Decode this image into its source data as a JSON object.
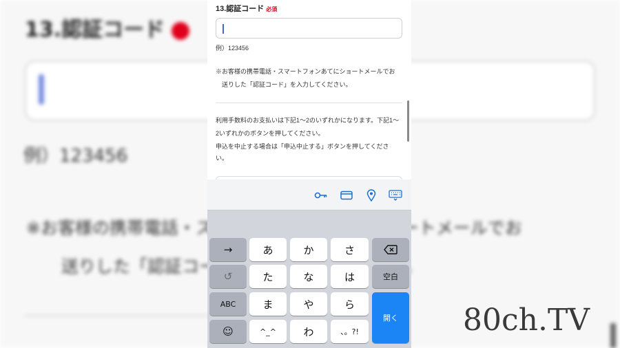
{
  "field": {
    "label": "13.認証コード",
    "required_badge": "必須",
    "input_value": ""
  },
  "example_text": "例）123456",
  "note_lines": [
    "※お客様の携帯電話・スマートフォンあてにショートメールでお",
    "　送りした「認証コード」を入力してください。"
  ],
  "payment_lines": [
    "利用手数料のお支払いは下記1〜2のいずれかになります。下記1〜",
    "2いずれかのボタンを押してください。",
    "申込を中止する場合は「申込中止する」ボタンを押してくださ",
    "い。"
  ],
  "toolbar_icons": [
    "key-icon",
    "credit-card-icon",
    "location-pin-icon",
    "keyboard-icon"
  ],
  "keyboard": {
    "row1": [
      "→",
      "あ",
      "か",
      "さ",
      "⌫"
    ],
    "row2": [
      "↺",
      "た",
      "な",
      "は",
      "空白"
    ],
    "row3": [
      "ABC",
      "ま",
      "や",
      "ら",
      "開く"
    ],
    "row4": [
      "☺",
      "^_^",
      "わ",
      "、。?!"
    ]
  },
  "watermark": "80ch.TV",
  "colors": {
    "accent": "#1b85f5",
    "required": "#e0001b",
    "keyboard_bg": "#d2d5db",
    "toolbar_icon": "#1b6fd1"
  }
}
